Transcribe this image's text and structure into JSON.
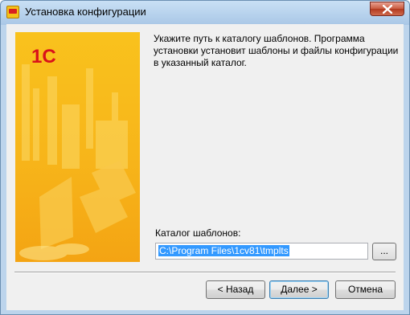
{
  "window": {
    "title": "Установка конфигурации"
  },
  "banner": {
    "logo_text": "1С"
  },
  "content": {
    "instruction": "Укажите путь к каталогу шаблонов. Программа установки установит шаблоны и файлы конфигурации в указанный каталог.",
    "catalog_label": "Каталог шаблонов:",
    "catalog_path": "C:\\Program Files\\1cv81\\tmplts",
    "browse_label": "..."
  },
  "buttons": {
    "back": "< Назад",
    "next": "Далее >",
    "cancel": "Отмена"
  },
  "colors": {
    "logo_red": "#d9121a",
    "banner_yellow": "#f7b81a",
    "selection": "#3399ff"
  }
}
